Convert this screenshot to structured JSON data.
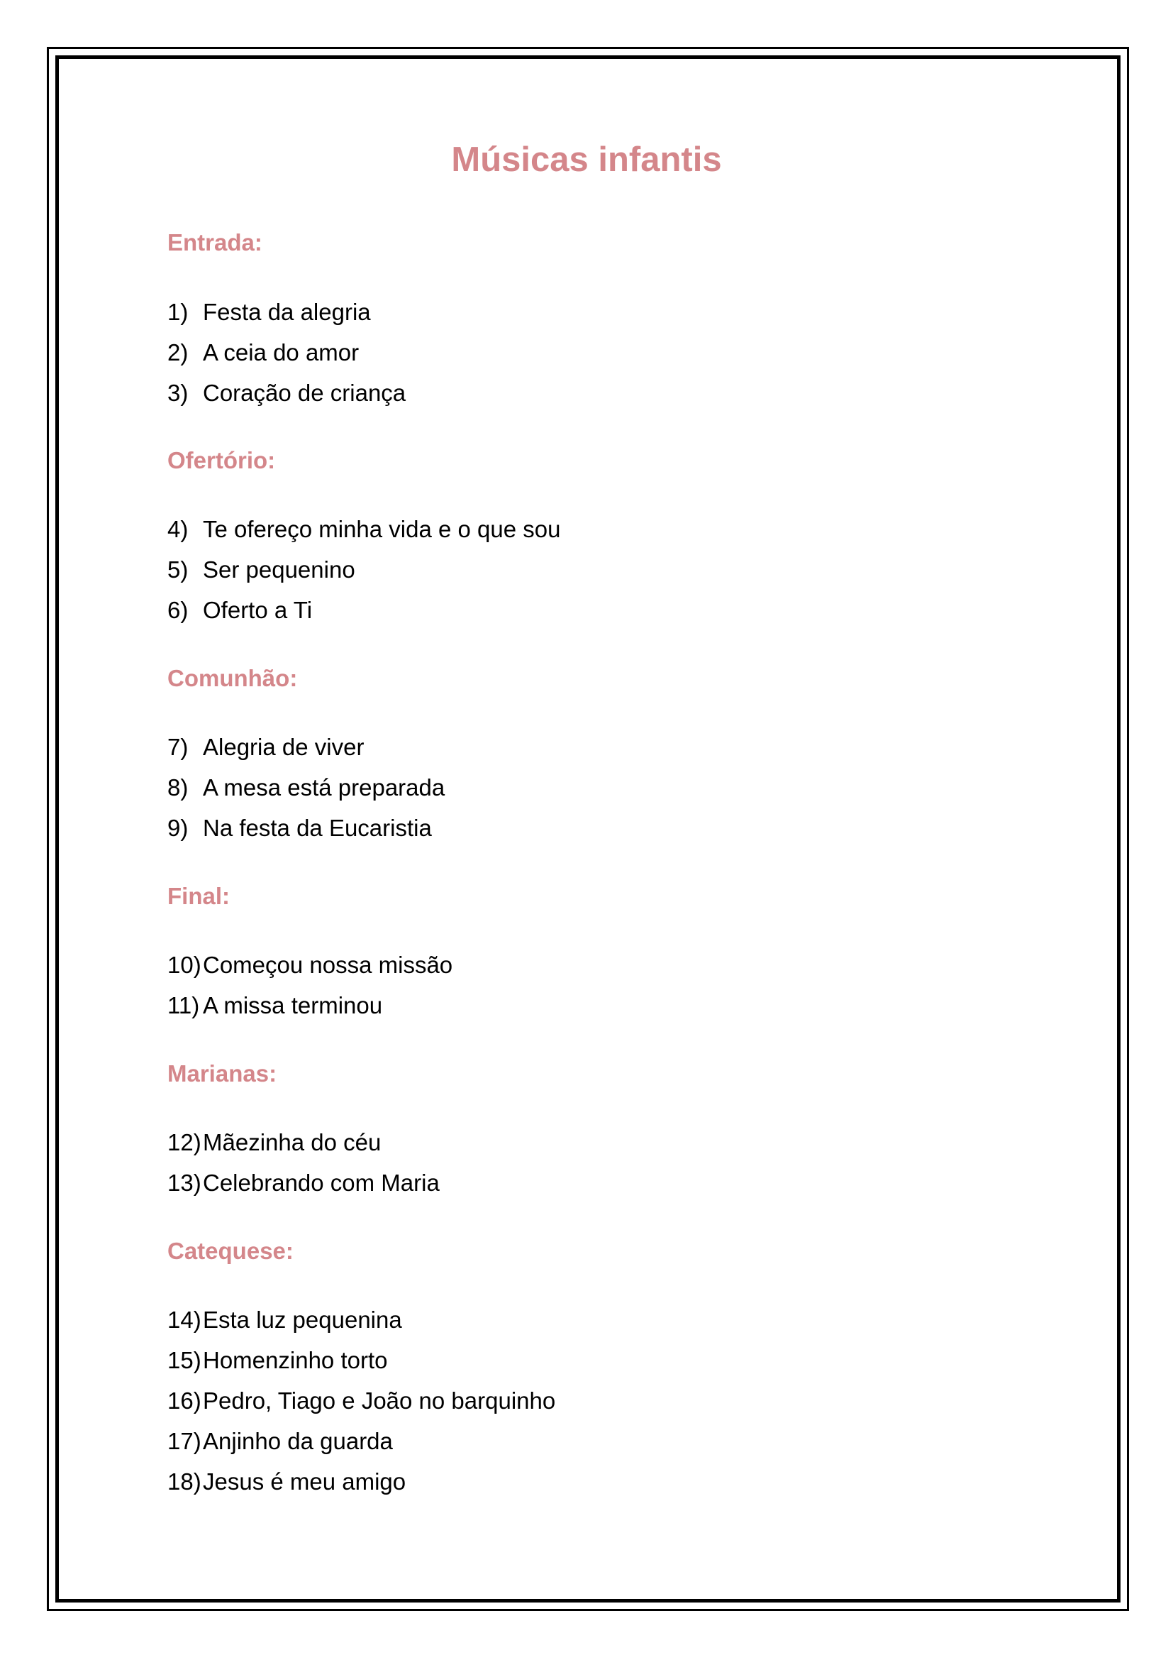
{
  "colors": {
    "heading": "#d4868a",
    "text": "#000000",
    "border": "#000000"
  },
  "document": {
    "title": "Músicas infantis",
    "sections": [
      {
        "heading": "Entrada:",
        "items": [
          {
            "num": "1)",
            "text": "Festa da alegria"
          },
          {
            "num": "2)",
            "text": "A ceia do amor"
          },
          {
            "num": "3)",
            "text": "Coração de criança"
          }
        ]
      },
      {
        "heading": "Ofertório:",
        "items": [
          {
            "num": "4)",
            "text": "Te ofereço minha vida e o que sou"
          },
          {
            "num": "5)",
            "text": "Ser pequenino"
          },
          {
            "num": "6)",
            "text": "Oferto a Ti"
          }
        ]
      },
      {
        "heading": "Comunhão:",
        "items": [
          {
            "num": "7)",
            "text": "Alegria de viver"
          },
          {
            "num": "8)",
            "text": "A mesa está preparada"
          },
          {
            "num": "9)",
            "text": "Na festa da Eucaristia"
          }
        ]
      },
      {
        "heading": "Final:",
        "items": [
          {
            "num": "10)",
            "text": "Começou nossa missão"
          },
          {
            "num": "11)",
            "text": "A missa terminou"
          }
        ]
      },
      {
        "heading": "Marianas:",
        "items": [
          {
            "num": "12)",
            "text": "Mãezinha do céu"
          },
          {
            "num": "13)",
            "text": "Celebrando com Maria"
          }
        ]
      },
      {
        "heading": "Catequese:",
        "items": [
          {
            "num": "14)",
            "text": "Esta luz pequenina"
          },
          {
            "num": "15)",
            "text": "Homenzinho torto"
          },
          {
            "num": "16)",
            "text": "Pedro, Tiago e João no barquinho"
          },
          {
            "num": "17)",
            "text": "Anjinho da guarda"
          },
          {
            "num": "18)",
            "text": "Jesus é meu amigo"
          }
        ]
      }
    ]
  }
}
